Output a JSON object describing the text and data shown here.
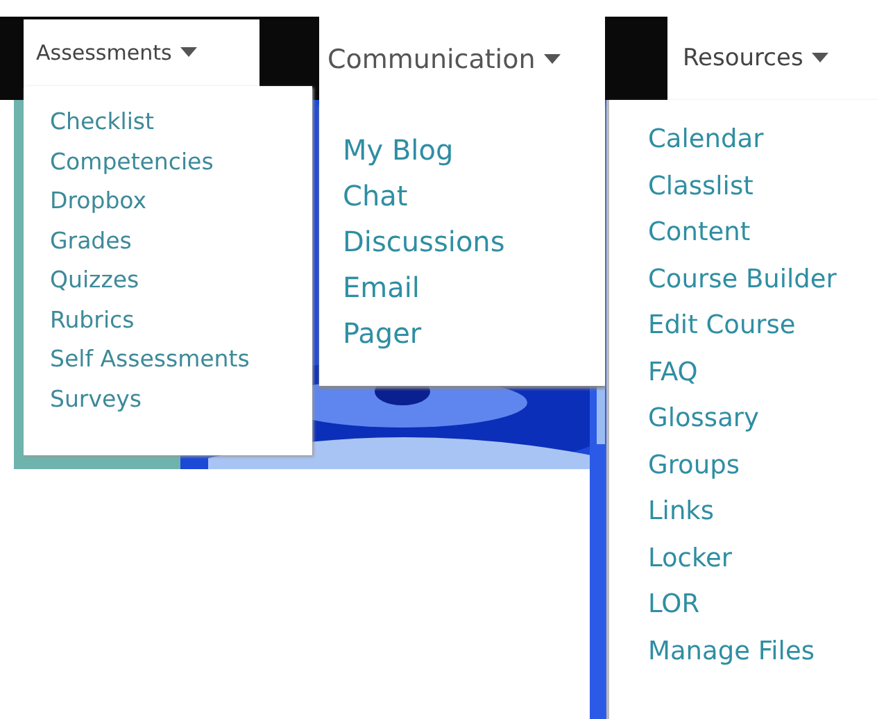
{
  "menus": [
    {
      "title": "Assessments",
      "items": [
        "Checklist",
        "Competencies",
        "Dropbox",
        "Grades",
        "Quizzes",
        "Rubrics",
        "Self Assessments",
        "Surveys"
      ]
    },
    {
      "title": "Communication",
      "items": [
        "My Blog",
        "Chat",
        "Discussions",
        "Email",
        "Pager"
      ]
    },
    {
      "title": "Resources",
      "items": [
        "Calendar",
        "Classlist",
        "Content",
        "Course Builder",
        "Edit Course",
        "FAQ",
        "Glossary",
        "Groups",
        "Links",
        "Locker",
        "LOR",
        "Manage Files"
      ]
    }
  ]
}
